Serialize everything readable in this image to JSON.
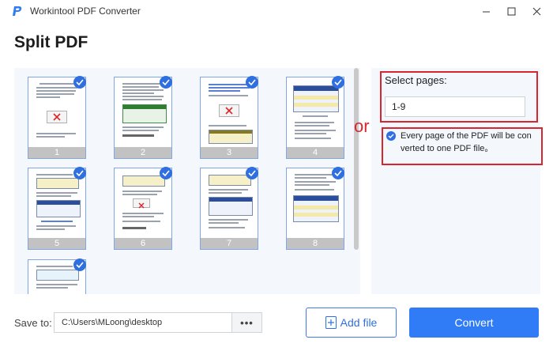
{
  "window": {
    "title": "Workintool PDF Converter",
    "logo_icon": "workintool-logo-icon",
    "brand_color": "#2f7cf6"
  },
  "page": {
    "title": "Split PDF"
  },
  "thumbnails": [
    {
      "page": "1",
      "selected": true
    },
    {
      "page": "2",
      "selected": true
    },
    {
      "page": "3",
      "selected": true
    },
    {
      "page": "4",
      "selected": true
    },
    {
      "page": "5",
      "selected": true
    },
    {
      "page": "6",
      "selected": true
    },
    {
      "page": "7",
      "selected": true
    },
    {
      "page": "8",
      "selected": true
    },
    {
      "page": "",
      "selected": true
    }
  ],
  "options": {
    "select_label": "Select pages:",
    "pages_value": "1-9",
    "or_label": "or",
    "every_page_text": "Every page of the PDF will be con verted to one PDF file。",
    "every_page_checked": true,
    "highlight_color": "#d9262e"
  },
  "footer": {
    "save_label": "Save to:",
    "save_path": "C:\\Users\\MLoong\\desktop",
    "browse_label": "•••",
    "add_file_label": "Add file",
    "convert_label": "Convert"
  }
}
